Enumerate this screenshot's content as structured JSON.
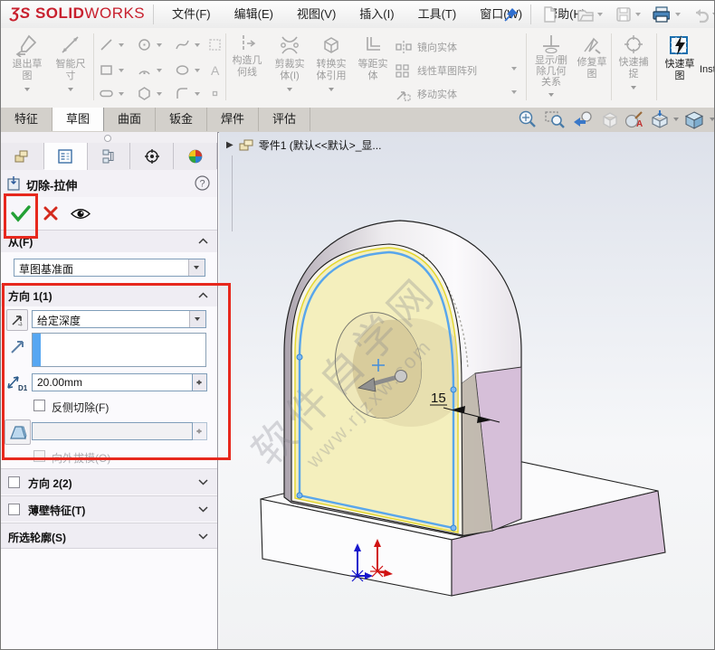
{
  "app": {
    "logo_prefix": "ƷS",
    "logo_bold": "SOLID",
    "logo_light": "WORKS",
    "brand_color": "#c8202e"
  },
  "menubar": {
    "items": [
      {
        "label": "文件(F)"
      },
      {
        "label": "编辑(E)"
      },
      {
        "label": "视图(V)"
      },
      {
        "label": "插入(I)"
      },
      {
        "label": "工具(T)"
      },
      {
        "label": "窗口(W)"
      },
      {
        "label": "帮助(H)"
      }
    ]
  },
  "ribbon": {
    "exit_sketch": {
      "lines": [
        "退出草",
        "图"
      ]
    },
    "smart_dimension": {
      "lines": [
        "智能尺",
        "寸"
      ]
    },
    "construction_geometry": {
      "lines": [
        "构造几",
        "何线"
      ]
    },
    "trim_entities": {
      "lines": [
        "剪裁实",
        "体(I)"
      ]
    },
    "convert_entities": {
      "lines": [
        "转换实",
        "体引用"
      ]
    },
    "offset_entities": {
      "lines": [
        "等距实",
        "体"
      ]
    },
    "mirror_entities": {
      "label": "镜向实体"
    },
    "linear_pattern": {
      "label": "线性草图阵列"
    },
    "move_entities": {
      "label": "移动实体"
    },
    "display_delete_relations": {
      "lines": [
        "显示/删",
        "除几何",
        "关系"
      ]
    },
    "repair_sketch": {
      "lines": [
        "修复草",
        "图"
      ]
    },
    "quick_snaps": {
      "lines": [
        "快速捕",
        "捉"
      ]
    },
    "rapid_sketch": {
      "lines": [
        "快速草",
        "图"
      ]
    },
    "instant2d_partial": "Inst"
  },
  "tabbar": {
    "tabs": [
      {
        "label": "特征"
      },
      {
        "label": "草图"
      },
      {
        "label": "曲面"
      },
      {
        "label": "钣金"
      },
      {
        "label": "焊件"
      },
      {
        "label": "评估"
      }
    ],
    "active_tab": "草图"
  },
  "panel": {
    "title": "切除-拉伸",
    "help_symbol": "?",
    "from_section": {
      "label": "从(F)",
      "plane_value": "草图基准面"
    },
    "direction1": {
      "label": "方向 1(1)",
      "end_condition": "给定深度",
      "depth_value": "20.00mm",
      "flip_side_label": "反侧切除(F)",
      "draft_outward_label": "向外拔模(O)"
    },
    "direction2_label": "方向 2(2)",
    "thin_feature_label": "薄壁特征(T)",
    "selected_contours_label": "所选轮廓(S)"
  },
  "viewport": {
    "part_tree_label": "零件1  (默认<<默认>_显...",
    "dimension_value": "15",
    "watermark_line1": "软件自学网",
    "watermark_line2": "www.rjzxw.com"
  },
  "colors": {
    "annotation_red": "#e7281d",
    "preview_yellow": "#f3eebb",
    "material_pink": "#d6c0d8",
    "sketch_blue": "#58a6ec",
    "accent_blue": "#1b6fae"
  }
}
